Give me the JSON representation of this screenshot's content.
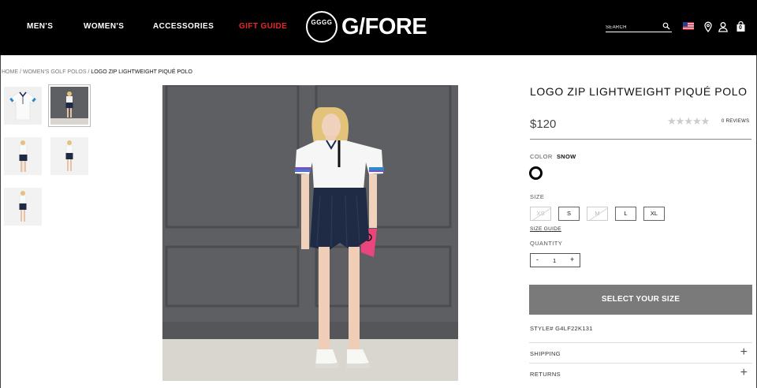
{
  "nav": {
    "items": [
      "MEN'S",
      "WOMEN'S",
      "ACCESSORIES",
      "GIFT GUIDE"
    ],
    "gift_color": "#e8262c"
  },
  "brand": {
    "mark": "GGGG",
    "name": "G/FORE"
  },
  "header": {
    "search_placeholder": "SEARCH",
    "icons": [
      "search-icon",
      "us-flag-icon",
      "location-pin-icon",
      "account-icon",
      "shopping-bag-icon"
    ],
    "cart_count": "0"
  },
  "breadcrumb": {
    "home": "HOME",
    "category": "WOMEN'S GOLF POLOS",
    "current": "LOGO ZIP LIGHTWEIGHT PIQUÉ POLO",
    "separator": "/"
  },
  "product": {
    "title": "LOGO ZIP LIGHTWEIGHT PIQUÉ POLO",
    "price": "$120",
    "rating_stars": 0,
    "reviews": "0 REVIEWS",
    "color_label": "COLOR",
    "color_value": "SNOW",
    "size_label": "SIZE",
    "sizes": [
      {
        "label": "XS",
        "available": false
      },
      {
        "label": "S",
        "available": true
      },
      {
        "label": "M",
        "available": false
      },
      {
        "label": "L",
        "available": true
      },
      {
        "label": "XL",
        "available": true
      }
    ],
    "size_guide": "SIZE GUIDE",
    "quantity_label": "QUANTITY",
    "quantity_minus": "-",
    "quantity": "1",
    "quantity_plus": "+",
    "cta": "SELECT YOUR SIZE",
    "style": "STYLE# G4LF22K131",
    "accordions": [
      "SHIPPING",
      "RETURNS"
    ],
    "accordion_icon": "+"
  },
  "colors": {
    "header_bg": "#000000",
    "cta_bg": "#7a7a7a",
    "wall": "#5d5f63",
    "floor": "#d9d6cf"
  }
}
